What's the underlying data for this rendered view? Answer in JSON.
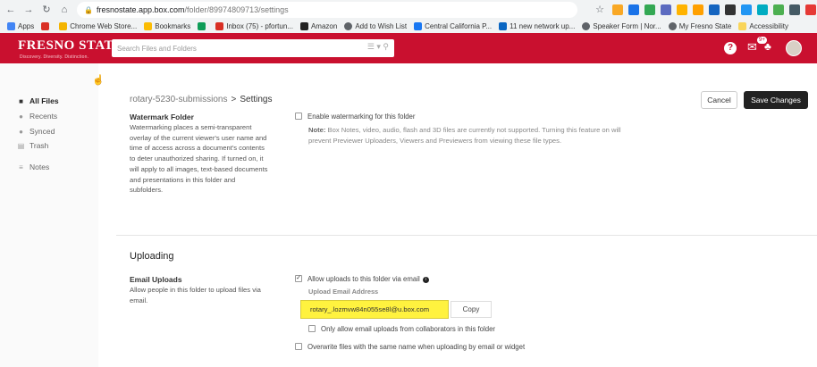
{
  "browser": {
    "url_host": "fresnostate.app.box.com",
    "url_path": "/folder/89974809713/settings",
    "bookmarks": [
      {
        "label": "Apps",
        "color": "#4285f4"
      },
      {
        "label": "",
        "color": "#d93025"
      },
      {
        "label": "Chrome Web Store...",
        "color": "#f4b400"
      },
      {
        "label": "Bookmarks",
        "color": "#fbbc04"
      },
      {
        "label": "",
        "color": "#0f9d58"
      },
      {
        "label": "Inbox (75) - pfortun...",
        "color": "#d93025"
      },
      {
        "label": "Amazon",
        "color": "#222222"
      },
      {
        "label": "Add to Wish List",
        "color": "#5f6368"
      },
      {
        "label": "Central California P...",
        "color": "#1877f2"
      },
      {
        "label": "11 new network up...",
        "color": "#0a66c2"
      },
      {
        "label": "Speaker Form | Nor...",
        "color": "#5f6368"
      },
      {
        "label": "My Fresno State",
        "color": "#5f6368"
      },
      {
        "label": "Accessibility",
        "color": "#f9d55a"
      }
    ]
  },
  "header": {
    "logo": "FRESNO STATE",
    "logo_tagline": "Discovery. Diversity. Distinction.",
    "search_placeholder": "Search Files and Folders",
    "notification_badge": "9+",
    "accent": "#c9102f"
  },
  "sidebar": {
    "items": [
      {
        "label": "All Files",
        "icon": "folder-icon",
        "active": true
      },
      {
        "label": "Recents",
        "icon": "clock-icon",
        "active": false
      },
      {
        "label": "Synced",
        "icon": "check-circle-icon",
        "active": false
      },
      {
        "label": "Trash",
        "icon": "trash-icon",
        "active": false
      },
      {
        "label": "Notes",
        "icon": "notes-icon",
        "active": false
      }
    ]
  },
  "breadcrumb": {
    "folder": "rotary-5230-submissions",
    "separator": ">",
    "current": "Settings"
  },
  "toolbar": {
    "cancel_label": "Cancel",
    "save_label": "Save Changes"
  },
  "watermark": {
    "title": "Watermark Folder",
    "description": "Watermarking places a semi-transparent overlay of the current viewer's user name and time of access across a document's contents to deter unauthorized sharing. If turned on, it will apply to all images, text-based documents and presentations in this folder and subfolders.",
    "checkbox_label": "Enable watermarking for this folder",
    "checked": false,
    "note_prefix": "Note:",
    "note_text": "Box Notes, video, audio, flash and 3D files are currently not supported. Turning this feature on will prevent Previewer Uploaders, Viewers and Previewers from viewing these file types."
  },
  "uploading": {
    "section_title": "Uploading",
    "email_title": "Email Uploads",
    "email_description": "Allow people in this folder to upload files via email.",
    "allow_label": "Allow uploads to this folder via email",
    "allow_checked": true,
    "address_label": "Upload Email Address",
    "address_value": "rotary_.lozmvw84n055se8l@u.box.com",
    "copy_label": "Copy",
    "collaborators_label": "Only allow email uploads from collaborators in this folder",
    "collaborators_checked": false,
    "overwrite_label": "Overwrite files with the same name when uploading by email or widget",
    "overwrite_checked": false
  }
}
